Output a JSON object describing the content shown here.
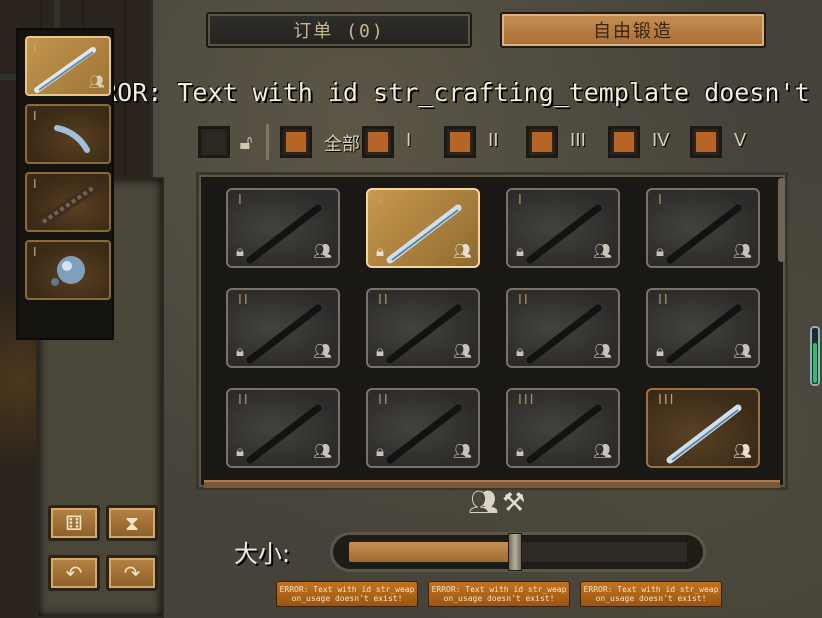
{
  "tabs": {
    "orders_label": "订单 (0)",
    "free_forge_label": "自由锻造"
  },
  "error_banner": "ERROR: Text with id str_crafting_template doesn't ex",
  "filters": {
    "all_label": "全部",
    "tiers": [
      "I",
      "II",
      "III",
      "IV",
      "V"
    ]
  },
  "sidebar": {
    "items": [
      {
        "tier": "I",
        "icon": "sword-blade-icon",
        "active": true
      },
      {
        "tier": "I",
        "icon": "guard-icon",
        "active": false
      },
      {
        "tier": "I",
        "icon": "grip-icon",
        "active": false
      },
      {
        "tier": "I",
        "icon": "pommel-icon",
        "active": false
      }
    ],
    "buttons": [
      {
        "name": "randomize-button",
        "icon": "dice-icon",
        "glyph": "⚅"
      },
      {
        "name": "history-button",
        "icon": "hourglass-icon",
        "glyph": "⧗"
      },
      {
        "name": "undo-button",
        "icon": "undo-arrow-icon",
        "glyph": "↶"
      },
      {
        "name": "redo-button",
        "icon": "redo-arrow-icon",
        "glyph": "↷"
      }
    ]
  },
  "grid": {
    "cards": [
      {
        "tier": "I",
        "state": "locked"
      },
      {
        "tier": "I",
        "state": "selected"
      },
      {
        "tier": "I",
        "state": "locked"
      },
      {
        "tier": "I",
        "state": "locked"
      },
      {
        "tier": "II",
        "state": "locked"
      },
      {
        "tier": "II",
        "state": "locked"
      },
      {
        "tier": "II",
        "state": "locked"
      },
      {
        "tier": "II",
        "state": "locked"
      },
      {
        "tier": "II",
        "state": "locked"
      },
      {
        "tier": "II",
        "state": "locked"
      },
      {
        "tier": "III",
        "state": "locked"
      },
      {
        "tier": "III",
        "state": "unlocked"
      }
    ]
  },
  "size": {
    "label": "大小:",
    "value_fraction": 0.48
  },
  "error_buttons": [
    "ERROR: Text with id str_weap on_usage doesn't exist!",
    "ERROR: Text with id str_weap on_usage doesn't exist!",
    "ERROR: Text with id str_weap on_usage doesn't exist!"
  ],
  "colors": {
    "accent_orange": "#b66526",
    "gold_selected": "#c9994f",
    "stone": "#45423a"
  }
}
